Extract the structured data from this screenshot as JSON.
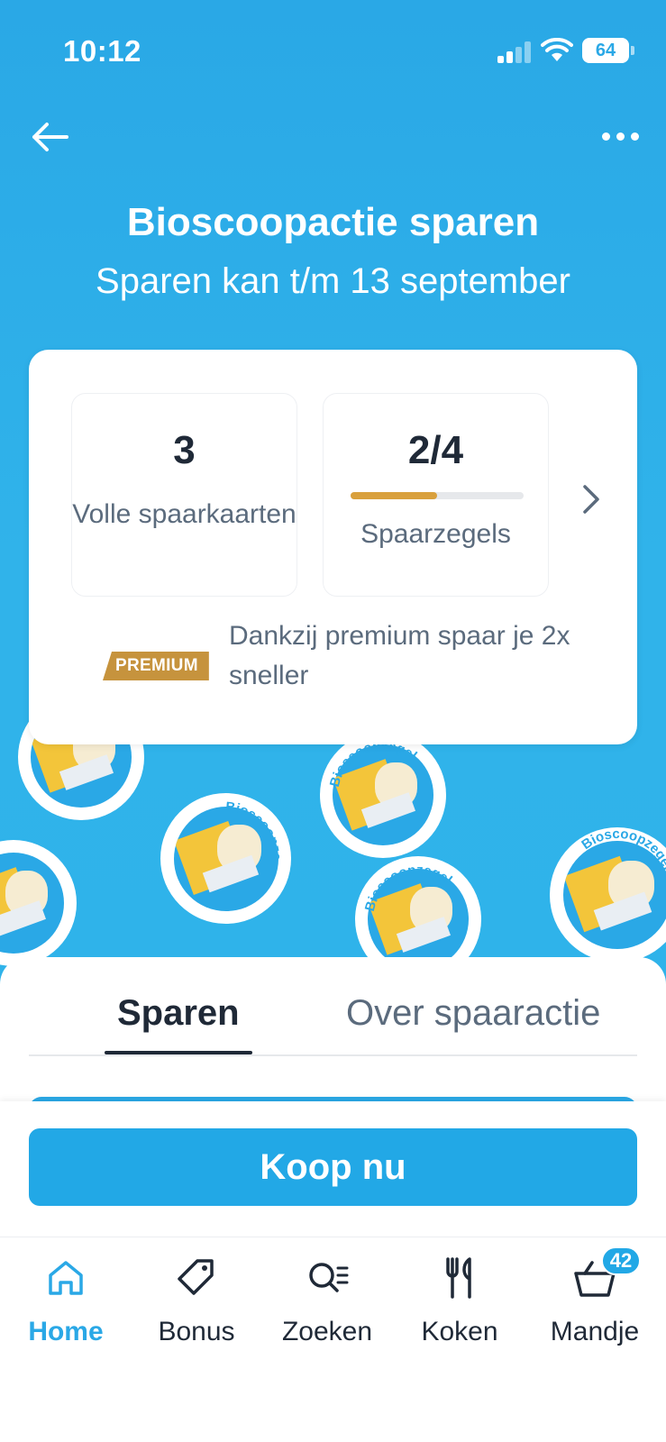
{
  "status_bar": {
    "time": "10:12",
    "battery": "64"
  },
  "header": {
    "title": "Bioscoopactie sparen",
    "subtitle": "Sparen kan t/m 13 september"
  },
  "summary_card": {
    "full_cards": {
      "value": "3",
      "label": "Volle spaarkaarten"
    },
    "stamps": {
      "value": "2/4",
      "label": "Spaarzegels",
      "progress_fraction": 0.5
    },
    "premium": {
      "badge": "PREMIUM",
      "text": "Dankzij premium spaar je 2x sneller"
    }
  },
  "sticker_text": "Bioscoopzegel",
  "tabs": [
    {
      "label": "Sparen",
      "active": true
    },
    {
      "label": "Over spaaractie",
      "active": false
    }
  ],
  "buy_button": {
    "label": "Koop nu"
  },
  "bottom_nav": {
    "items": [
      {
        "label": "Home",
        "icon": "home-icon",
        "active": true
      },
      {
        "label": "Bonus",
        "icon": "tag-icon",
        "active": false
      },
      {
        "label": "Zoeken",
        "icon": "search-list-icon",
        "active": false
      },
      {
        "label": "Koken",
        "icon": "fork-knife-icon",
        "active": false
      },
      {
        "label": "Mandje",
        "icon": "basket-icon",
        "active": false,
        "badge": "42"
      }
    ]
  },
  "colors": {
    "accent": "#2aa8e6",
    "premium": "#c6933d",
    "progress": "#d9a03d",
    "text_dark": "#1f2937",
    "text_muted": "#5b6b7d"
  }
}
